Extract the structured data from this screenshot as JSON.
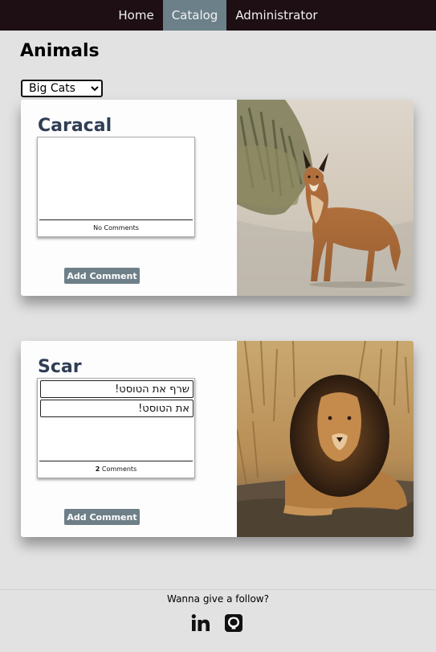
{
  "nav": {
    "items": [
      {
        "label": "Home",
        "active": false
      },
      {
        "label": "Catalog",
        "active": true
      },
      {
        "label": "Administrator",
        "active": false
      }
    ]
  },
  "page": {
    "title": "Animals",
    "category_selected": "Big Cats"
  },
  "cards": [
    {
      "name": "Caracal",
      "comments": [],
      "comments_summary": "No Comments",
      "add_comment_label": "Add Comment",
      "photo": "caracal-photo"
    },
    {
      "name": "Scar",
      "comments": [
        "שרף את הטוסט!",
        "את הטוסט!"
      ],
      "comment_count": "2",
      "comments_label": "Comments",
      "add_comment_label": "Add Comment",
      "photo": "lion-photo"
    }
  ],
  "footer": {
    "text": "Wanna give a follow?",
    "social": [
      {
        "icon": "linkedin-icon"
      },
      {
        "icon": "github-icon"
      }
    ]
  },
  "colors": {
    "nav_bg": "#1d0f14",
    "nav_active": "#6b8089",
    "page_bg": "#e2e2e2",
    "card_title": "#2f3e55",
    "button_bg": "#6e7f88"
  }
}
